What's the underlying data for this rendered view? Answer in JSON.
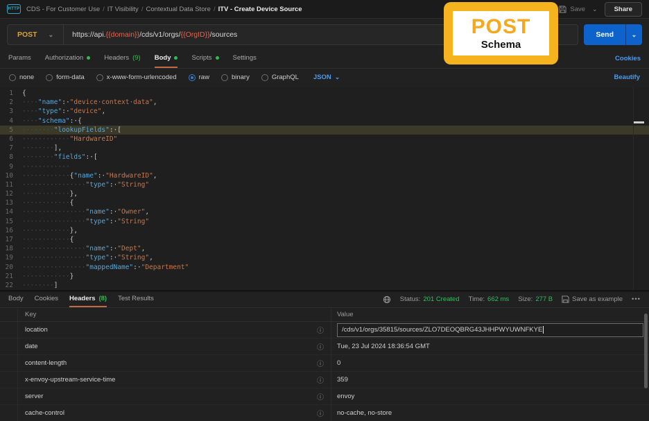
{
  "topbar": {
    "icon_label": "HTTP",
    "breadcrumb": [
      "CDS - For Customer Use",
      "IT Visibility",
      "Contextual Data Store"
    ],
    "current": "ITV - Create Device Source",
    "save": "Save",
    "share": "Share"
  },
  "request": {
    "method": "POST",
    "url_parts": [
      {
        "t": "https://api.",
        "v": false
      },
      {
        "t": "{{domain}}",
        "v": true
      },
      {
        "t": "/cds/v1/orgs/",
        "v": false
      },
      {
        "t": "{{OrgID}}",
        "v": true
      },
      {
        "t": "/sources",
        "v": false
      }
    ],
    "send": "Send"
  },
  "req_tabs": {
    "items": [
      {
        "label": "Params"
      },
      {
        "label": "Authorization",
        "dot": true
      },
      {
        "label": "Headers",
        "count": "(9)"
      },
      {
        "label": "Body",
        "dot": true,
        "active": true
      },
      {
        "label": "Scripts",
        "dot": true
      },
      {
        "label": "Settings"
      }
    ],
    "cookies": "Cookies"
  },
  "body_opts": {
    "options": [
      "none",
      "form-data",
      "x-www-form-urlencoded",
      "raw",
      "binary",
      "GraphQL"
    ],
    "selected": "raw",
    "format": "JSON",
    "beautify": "Beautify"
  },
  "editor": {
    "lines": [
      {
        "n": 1,
        "tk": [
          [
            "p",
            "{"
          ]
        ]
      },
      {
        "n": 2,
        "tk": [
          [
            "w",
            4
          ],
          [
            "k",
            "\"name\""
          ],
          [
            "p",
            ": "
          ],
          [
            "s",
            "\"device context data\""
          ],
          [
            "p",
            ","
          ]
        ]
      },
      {
        "n": 3,
        "tk": [
          [
            "w",
            4
          ],
          [
            "k",
            "\"type\""
          ],
          [
            "p",
            ": "
          ],
          [
            "s",
            "\"device\""
          ],
          [
            "p",
            ","
          ]
        ]
      },
      {
        "n": 4,
        "tk": [
          [
            "w",
            4
          ],
          [
            "k",
            "\"schema\""
          ],
          [
            "p",
            ": {"
          ]
        ]
      },
      {
        "n": 5,
        "hl": true,
        "tk": [
          [
            "w",
            8
          ],
          [
            "k",
            "\"lookupFields\""
          ],
          [
            "p",
            ": ["
          ]
        ]
      },
      {
        "n": 6,
        "tk": [
          [
            "w",
            12
          ],
          [
            "s",
            "\"HardwareID\""
          ]
        ]
      },
      {
        "n": 7,
        "tk": [
          [
            "w",
            8
          ],
          [
            "p",
            "],"
          ]
        ]
      },
      {
        "n": 8,
        "tk": [
          [
            "w",
            8
          ],
          [
            "k",
            "\"fields\""
          ],
          [
            "p",
            ": ["
          ]
        ]
      },
      {
        "n": 9,
        "tk": [
          [
            "w",
            12
          ]
        ]
      },
      {
        "n": 10,
        "tk": [
          [
            "w",
            12
          ],
          [
            "p",
            "{"
          ],
          [
            "k",
            "\"name\""
          ],
          [
            "p",
            ": "
          ],
          [
            "s",
            "\"HardwareID\""
          ],
          [
            "p",
            ","
          ]
        ]
      },
      {
        "n": 11,
        "tk": [
          [
            "w",
            16
          ],
          [
            "k",
            "\"type\""
          ],
          [
            "p",
            ": "
          ],
          [
            "s",
            "\"String\""
          ]
        ]
      },
      {
        "n": 12,
        "tk": [
          [
            "w",
            12
          ],
          [
            "p",
            "},"
          ]
        ]
      },
      {
        "n": 13,
        "tk": [
          [
            "w",
            12
          ],
          [
            "p",
            "{"
          ]
        ]
      },
      {
        "n": 14,
        "tk": [
          [
            "w",
            16
          ],
          [
            "k",
            "\"name\""
          ],
          [
            "p",
            ": "
          ],
          [
            "s",
            "\"Owner\""
          ],
          [
            "p",
            ","
          ]
        ]
      },
      {
        "n": 15,
        "tk": [
          [
            "w",
            16
          ],
          [
            "k",
            "\"type\""
          ],
          [
            "p",
            ": "
          ],
          [
            "s",
            "\"String\""
          ]
        ]
      },
      {
        "n": 16,
        "tk": [
          [
            "w",
            12
          ],
          [
            "p",
            "},"
          ]
        ]
      },
      {
        "n": 17,
        "tk": [
          [
            "w",
            12
          ],
          [
            "p",
            "{"
          ]
        ]
      },
      {
        "n": 18,
        "tk": [
          [
            "w",
            16
          ],
          [
            "k",
            "\"name\""
          ],
          [
            "p",
            ": "
          ],
          [
            "s",
            "\"Dept\""
          ],
          [
            "p",
            ","
          ]
        ]
      },
      {
        "n": 19,
        "tk": [
          [
            "w",
            16
          ],
          [
            "k",
            "\"type\""
          ],
          [
            "p",
            ": "
          ],
          [
            "s",
            "\"String\""
          ],
          [
            "p",
            ","
          ]
        ]
      },
      {
        "n": 20,
        "tk": [
          [
            "w",
            16
          ],
          [
            "k",
            "\"mappedName\""
          ],
          [
            "p",
            ": "
          ],
          [
            "s",
            "\"Department\""
          ]
        ]
      },
      {
        "n": 21,
        "tk": [
          [
            "w",
            12
          ],
          [
            "p",
            "}"
          ]
        ]
      },
      {
        "n": 22,
        "tk": [
          [
            "w",
            8
          ],
          [
            "p",
            "]"
          ]
        ]
      }
    ]
  },
  "badge": {
    "title": "POST",
    "subtitle": "Schema"
  },
  "response": {
    "tabs": [
      {
        "label": "Body"
      },
      {
        "label": "Cookies"
      },
      {
        "label": "Headers",
        "count": "(8)",
        "active": true
      },
      {
        "label": "Test Results"
      }
    ],
    "status_label": "Status:",
    "status": "201 Created",
    "time_label": "Time:",
    "time": "662 ms",
    "size_label": "Size:",
    "size": "277 B",
    "save_example": "Save as example",
    "more": "•••",
    "table": {
      "key": "Key",
      "value": "Value",
      "rows": [
        {
          "key": "location",
          "value": "/cds/v1/orgs/35815/sources/ZLO7DEOQBRG43JHHPWYUWNFKYE",
          "editing": true
        },
        {
          "key": "date",
          "value": "Tue, 23 Jul 2024 18:36:54 GMT"
        },
        {
          "key": "content-length",
          "value": "0"
        },
        {
          "key": "x-envoy-upstream-service-time",
          "value": "359"
        },
        {
          "key": "server",
          "value": "envoy"
        },
        {
          "key": "cache-control",
          "value": "no-cache, no-store"
        }
      ]
    }
  },
  "colors": {
    "method_yellow": "#d7a43b",
    "variable_orange": "#e8614a",
    "tab_underline_orange": "#c26a42",
    "send_blue": "#0d62cc",
    "link_blue": "#4e9bef",
    "dot_green": "#27c24c",
    "status_green": "#2fbd60",
    "badge_yellow": "#f5b31f",
    "editor_highlight": "#3b3a29"
  }
}
